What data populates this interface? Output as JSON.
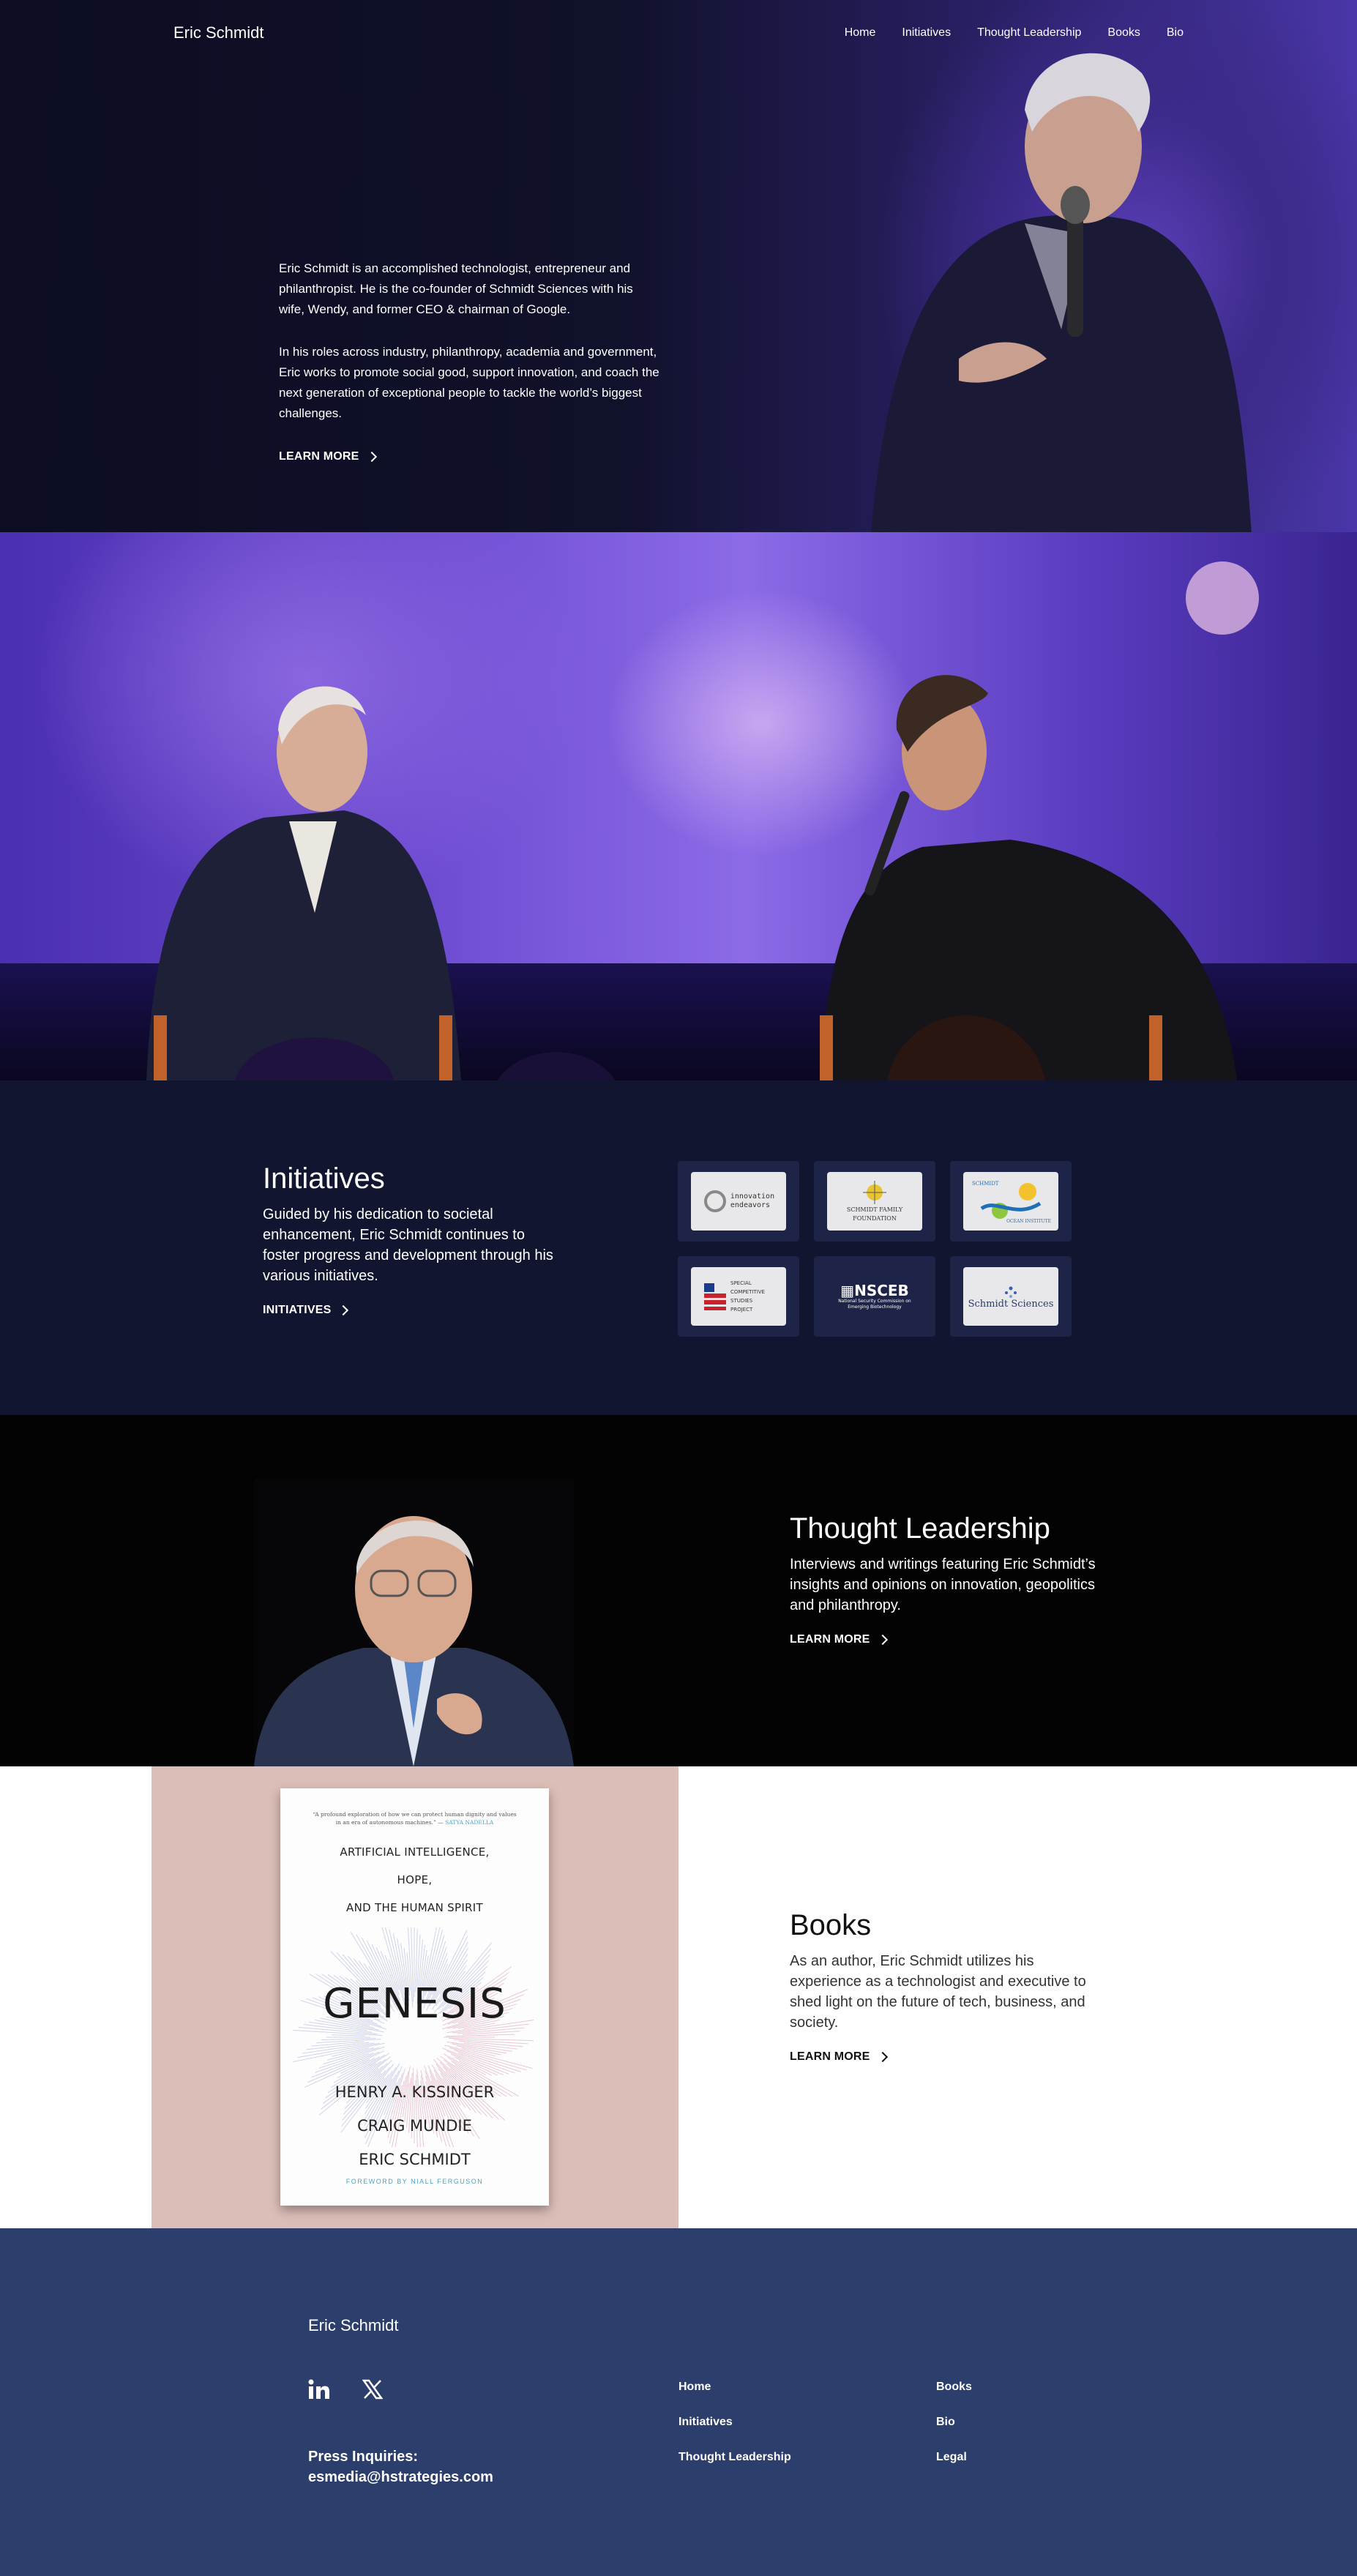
{
  "nav": {
    "logo": "Eric Schmidt",
    "links": [
      "Home",
      "Initiatives",
      "Thought Leadership",
      "Books",
      "Bio"
    ]
  },
  "hero": {
    "para1": "Eric Schmidt is an accomplished technologist, entrepreneur and philanthropist. He is the co-founder of Schmidt Sciences with his wife, Wendy, and former CEO & chairman of Google.",
    "para2": "In his roles across industry, philanthropy, academia and government, Eric works to promote social good, support innovation, and coach the next generation of exceptional people to tackle the world’s biggest challenges.",
    "cta": "LEARN MORE"
  },
  "initiatives": {
    "title": "Initiatives",
    "body": "Guided by his dedication to societal enhancement, Eric Schmidt continues to foster progress and development through his various initiatives.",
    "cta": "INITIATIVES",
    "logos": [
      {
        "line1": "innovation",
        "line2": "endeavors"
      },
      {
        "line1": "SCHMIDT FAMILY",
        "line2": "FOUNDATION"
      },
      {
        "line1": "SCHMIDT",
        "line2": "OCEAN INSTITUTE"
      },
      {
        "line1": "SPECIAL COMPETITIVE",
        "line2": "STUDIES PROJECT"
      },
      {
        "line1": "NSCEB",
        "line2": "National Security Commission on Emerging Biotechnology"
      },
      {
        "line1": "Schmidt Sciences",
        "line2": ""
      }
    ]
  },
  "thought": {
    "title": "Thought Leadership",
    "body": "Interviews and writings featuring Eric Schmidt’s insights and opinions on innovation, geopolitics and philanthropy.",
    "cta": "LEARN MORE"
  },
  "books": {
    "title": "Books",
    "body": "As an author, Eric Schmidt utilizes his experience as a technologist and executive to shed light on the future of tech, business, and society.",
    "cta": "LEARN MORE",
    "cover": {
      "quote": "“A profound exploration of how we can protect human dignity and values in an era of autonomous machines.” —",
      "quote_author": "SATYA NADELLA",
      "subtitle_lines": [
        "ARTIFICIAL INTELLIGENCE,",
        "HOPE,",
        "AND THE HUMAN SPIRIT"
      ],
      "title": "GENESIS",
      "authors": [
        "HENRY A. KISSINGER",
        "CRAIG MUNDIE",
        "ERIC SCHMIDT"
      ],
      "foreword": "FOREWORD BY NIALL FERGUSON"
    }
  },
  "footer": {
    "logo": "Eric Schmidt",
    "press_label": "Press Inquiries:",
    "press_email": "esmedia@hstrategies.com",
    "col1": [
      "Home",
      "Initiatives",
      "Thought Leadership"
    ],
    "col2": [
      "Books",
      "Bio",
      "Legal"
    ],
    "social": [
      "linkedin-icon",
      "x-icon"
    ]
  }
}
